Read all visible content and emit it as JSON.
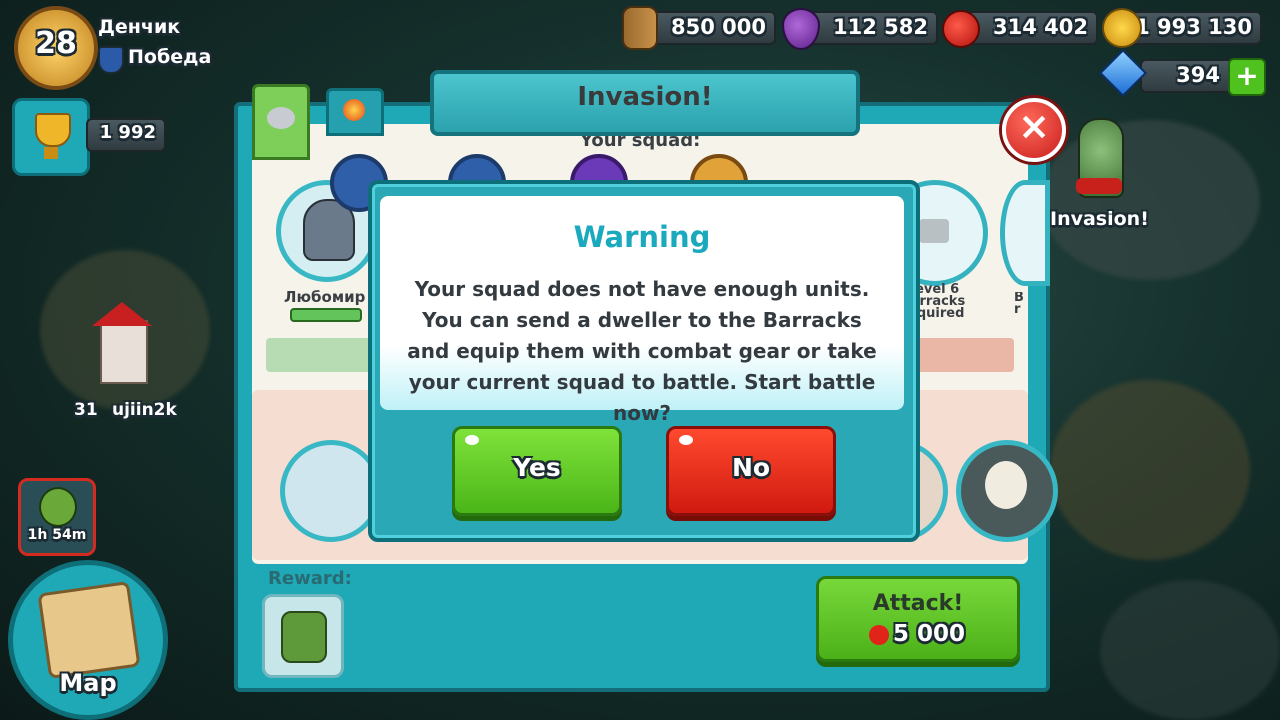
{
  "player": {
    "level": "28",
    "name": "Денчик",
    "status": "Победа",
    "trophies": "1 992"
  },
  "resources": {
    "wood": "850 000",
    "potion": "112 582",
    "food": "314 402",
    "gold": "1 993 130",
    "gems": "394"
  },
  "map_labels": {
    "castle_count": "31",
    "castle_owner": "ujiin2k",
    "invasion_label": "Invasion!",
    "timer": "1h 54m",
    "map_button": "Map"
  },
  "panel": {
    "title": "Invasion!",
    "squad_label": "Your squad:",
    "hero_name": "Любомир",
    "locked_slot_1": "Level 6 Barracks required",
    "locked_slot_2": "B r",
    "reward_label": "Reward:",
    "attack_label": "Attack!",
    "attack_cost": "5 000"
  },
  "dialog": {
    "title": "Warning",
    "message": "Your squad does not have enough units. You can send a dweller to the Barracks and equip them with combat gear or take your current squad to battle. Start battle now?",
    "yes_label": "Yes",
    "no_label": "No"
  },
  "colors": {
    "accent": "#1fa9b6",
    "yes": "#5cc620",
    "no": "#e4241a",
    "title": "#1aa9bd"
  },
  "icons": [
    "wood-icon",
    "potion-icon",
    "apple-icon",
    "gold-coin-icon",
    "gem-icon",
    "plus-icon",
    "trophy-icon",
    "close-icon",
    "map-icon",
    "knight-icon",
    "fire-icon"
  ]
}
